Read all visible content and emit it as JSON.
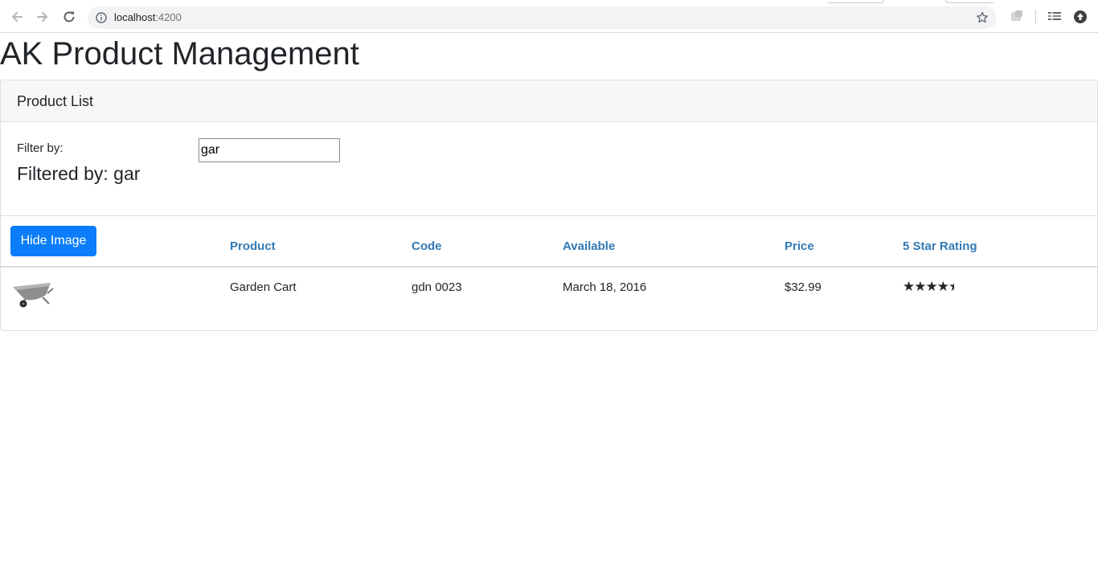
{
  "browser": {
    "url_host": "localhost",
    "url_port": ":4200",
    "icons": [
      "back-arrow-icon",
      "forward-arrow-icon",
      "reload-icon",
      "info-icon",
      "bookmark-star-icon",
      "extension-icon",
      "cast-icon",
      "profile-icon"
    ]
  },
  "page": {
    "title": "AK Product Management"
  },
  "card": {
    "header": "Product List",
    "filter_label": "Filter by:",
    "filter_value": "gar",
    "filtered_by": "Filtered by: gar",
    "toggle_button": "Hide Image"
  },
  "table": {
    "headers": [
      "Product",
      "Code",
      "Available",
      "Price",
      "5 Star Rating"
    ],
    "rows": [
      {
        "image": "garden-cart",
        "product": "Garden Cart",
        "code": "gdn 0023",
        "available": "March 18, 2016",
        "price": "$32.99",
        "rating": 4.2,
        "rating_max": 5
      }
    ]
  },
  "colors": {
    "accent": "#0b7dfa",
    "header_link": "#337ab7",
    "text": "#212529"
  }
}
